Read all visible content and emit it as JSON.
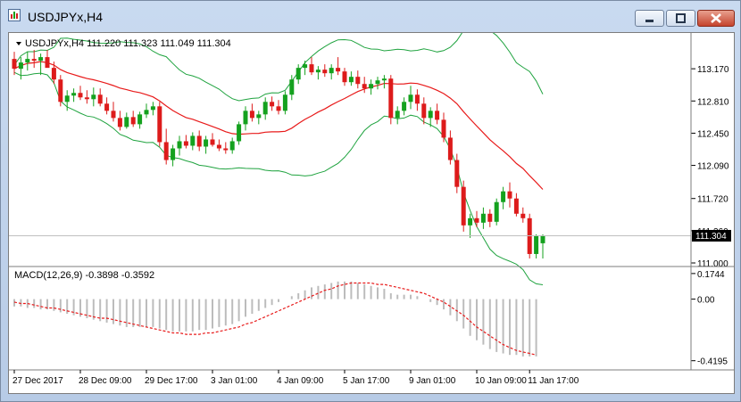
{
  "window": {
    "title": "USDJPYx,H4",
    "buttons": [
      "minimize-icon",
      "restore-icon",
      "close-icon"
    ]
  },
  "colors": {
    "bull": "#14a11e",
    "bear": "#dd1b1b",
    "ma": "#e81a1a",
    "bands": "#1fa33f",
    "macd_hist": "#bcbcbc",
    "signal": "#e81a1a",
    "price_box": "#000000"
  },
  "chart_data": [
    {
      "type": "candlestick",
      "symbol_info": "USDJPYx,H4  111.220 111.323 111.049 111.304",
      "ohlc": {
        "open": 111.22,
        "high": 111.323,
        "low": 111.049,
        "close": 111.304
      },
      "current_price_label": "111.304",
      "y_ticks": [
        "113.170",
        "112.810",
        "112.450",
        "112.090",
        "111.720",
        "111.360",
        "111.000"
      ],
      "ylim": [
        110.98,
        113.53
      ],
      "x_tick_labels": [
        "27 Dec 2017",
        "28 Dec 09:00",
        "29 Dec 17:00",
        "3 Jan 01:00",
        "4 Jan 09:00",
        "5 Jan 17:00",
        "9 Jan 01:00",
        "10 Jan 09:00",
        "11 Jan 17:00"
      ],
      "indicators": [
        "moving average (red)",
        "Bollinger/envelope bands (green)"
      ],
      "candles": [
        [
          113.28,
          113.36,
          113.1,
          113.17
        ],
        [
          113.17,
          113.3,
          113.05,
          113.24
        ],
        [
          113.24,
          113.36,
          113.15,
          113.28
        ],
        [
          113.28,
          113.38,
          113.18,
          113.26
        ],
        [
          113.26,
          113.34,
          113.1,
          113.3
        ],
        [
          113.3,
          113.38,
          113.2,
          113.18
        ],
        [
          113.18,
          113.25,
          113.0,
          113.05
        ],
        [
          113.05,
          113.1,
          112.75,
          112.8
        ],
        [
          112.8,
          112.93,
          112.7,
          112.87
        ],
        [
          112.87,
          112.95,
          112.8,
          112.9
        ],
        [
          112.9,
          112.98,
          112.82,
          112.85
        ],
        [
          112.85,
          112.93,
          112.78,
          112.83
        ],
        [
          112.83,
          112.96,
          112.75,
          112.88
        ],
        [
          112.88,
          112.95,
          112.75,
          112.78
        ],
        [
          112.78,
          112.85,
          112.66,
          112.7
        ],
        [
          112.7,
          112.8,
          112.58,
          112.62
        ],
        [
          112.62,
          112.7,
          112.48,
          112.52
        ],
        [
          112.52,
          112.68,
          112.5,
          112.63
        ],
        [
          112.63,
          112.7,
          112.52,
          112.55
        ],
        [
          112.55,
          112.69,
          112.5,
          112.66
        ],
        [
          112.66,
          112.78,
          112.62,
          112.71
        ],
        [
          112.71,
          112.8,
          112.65,
          112.75
        ],
        [
          112.75,
          112.8,
          112.3,
          112.35
        ],
        [
          112.35,
          112.5,
          112.1,
          112.15
        ],
        [
          112.15,
          112.32,
          112.08,
          112.28
        ],
        [
          112.28,
          112.42,
          112.2,
          112.36
        ],
        [
          112.36,
          112.43,
          112.28,
          112.31
        ],
        [
          112.31,
          112.46,
          112.26,
          112.42
        ],
        [
          112.42,
          112.48,
          112.25,
          112.3
        ],
        [
          112.3,
          112.42,
          112.22,
          112.38
        ],
        [
          112.38,
          112.45,
          112.3,
          112.32
        ],
        [
          112.32,
          112.38,
          112.25,
          112.28
        ],
        [
          112.28,
          112.35,
          112.22,
          112.26
        ],
        [
          112.26,
          112.4,
          112.22,
          112.36
        ],
        [
          112.36,
          112.58,
          112.32,
          112.55
        ],
        [
          112.55,
          112.75,
          112.48,
          112.7
        ],
        [
          112.7,
          112.78,
          112.58,
          112.62
        ],
        [
          112.62,
          112.7,
          112.55,
          112.66
        ],
        [
          112.66,
          112.85,
          112.6,
          112.8
        ],
        [
          112.8,
          112.86,
          112.7,
          112.75
        ],
        [
          112.75,
          112.82,
          112.66,
          112.7
        ],
        [
          112.7,
          112.92,
          112.66,
          112.88
        ],
        [
          112.88,
          113.1,
          112.82,
          113.05
        ],
        [
          113.05,
          113.22,
          113.0,
          113.18
        ],
        [
          113.18,
          113.26,
          113.1,
          113.22
        ],
        [
          113.22,
          113.3,
          113.1,
          113.13
        ],
        [
          113.13,
          113.2,
          113.05,
          113.16
        ],
        [
          113.16,
          113.22,
          113.08,
          113.12
        ],
        [
          113.12,
          113.22,
          113.05,
          113.18
        ],
        [
          113.18,
          113.3,
          113.1,
          113.14
        ],
        [
          113.14,
          113.18,
          112.98,
          113.02
        ],
        [
          113.02,
          113.14,
          112.98,
          113.08
        ],
        [
          113.08,
          113.15,
          112.95,
          113.0
        ],
        [
          113.0,
          113.08,
          112.9,
          112.95
        ],
        [
          112.95,
          113.05,
          112.88,
          113.0
        ],
        [
          113.0,
          113.08,
          112.94,
          113.04
        ],
        [
          113.04,
          113.1,
          112.95,
          113.06
        ],
        [
          113.06,
          113.1,
          112.55,
          112.62
        ],
        [
          112.62,
          112.75,
          112.55,
          112.7
        ],
        [
          112.7,
          112.85,
          112.65,
          112.8
        ],
        [
          112.8,
          112.98,
          112.72,
          112.88
        ],
        [
          112.88,
          112.94,
          112.7,
          112.78
        ],
        [
          112.78,
          112.85,
          112.55,
          112.62
        ],
        [
          112.62,
          112.74,
          112.52,
          112.7
        ],
        [
          112.7,
          112.78,
          112.55,
          112.6
        ],
        [
          112.6,
          112.68,
          112.35,
          112.4
        ],
        [
          112.4,
          112.48,
          112.1,
          112.15
        ],
        [
          112.15,
          112.22,
          111.78,
          111.85
        ],
        [
          111.85,
          111.92,
          111.35,
          111.42
        ],
        [
          111.42,
          111.55,
          111.28,
          111.5
        ],
        [
          111.5,
          111.58,
          111.4,
          111.45
        ],
        [
          111.45,
          111.62,
          111.38,
          111.55
        ],
        [
          111.55,
          111.6,
          111.4,
          111.46
        ],
        [
          111.46,
          111.72,
          111.42,
          111.68
        ],
        [
          111.68,
          111.85,
          111.6,
          111.8
        ],
        [
          111.8,
          111.9,
          111.62,
          111.72
        ],
        [
          111.72,
          111.78,
          111.52,
          111.55
        ],
        [
          111.55,
          111.62,
          111.45,
          111.5
        ],
        [
          111.5,
          111.55,
          111.05,
          111.1
        ],
        [
          111.1,
          111.32,
          111.05,
          111.3
        ],
        [
          111.22,
          111.32,
          111.05,
          111.3
        ]
      ]
    },
    {
      "type": "bar",
      "title": "MACD(12,26,9) -0.3898 -0.3592",
      "label": "MACD(12,26,9)",
      "values_text": [
        "-0.3898",
        "-0.3592"
      ],
      "y_ticks": [
        "0.1744",
        "0.00",
        "-0.4195"
      ],
      "ylim": [
        -0.47,
        0.21
      ],
      "histogram": [
        -0.05,
        -0.05,
        -0.06,
        -0.06,
        -0.07,
        -0.07,
        -0.08,
        -0.09,
        -0.1,
        -0.11,
        -0.12,
        -0.13,
        -0.14,
        -0.15,
        -0.16,
        -0.17,
        -0.18,
        -0.19,
        -0.19,
        -0.19,
        -0.19,
        -0.19,
        -0.2,
        -0.21,
        -0.22,
        -0.22,
        -0.22,
        -0.22,
        -0.21,
        -0.21,
        -0.2,
        -0.19,
        -0.18,
        -0.17,
        -0.15,
        -0.12,
        -0.1,
        -0.08,
        -0.06,
        -0.04,
        -0.02,
        0.0,
        0.02,
        0.04,
        0.06,
        0.08,
        0.09,
        0.1,
        0.11,
        0.12,
        0.12,
        0.12,
        0.11,
        0.1,
        0.09,
        0.08,
        0.07,
        0.04,
        0.03,
        0.03,
        0.03,
        0.02,
        0.0,
        -0.02,
        -0.04,
        -0.07,
        -0.11,
        -0.15,
        -0.2,
        -0.25,
        -0.28,
        -0.31,
        -0.34,
        -0.36,
        -0.37,
        -0.38,
        -0.38,
        -0.39,
        -0.39,
        -0.39
      ],
      "signal": [
        -0.02,
        -0.03,
        -0.03,
        -0.04,
        -0.05,
        -0.06,
        -0.06,
        -0.07,
        -0.08,
        -0.09,
        -0.1,
        -0.11,
        -0.12,
        -0.13,
        -0.13,
        -0.14,
        -0.15,
        -0.16,
        -0.17,
        -0.18,
        -0.19,
        -0.2,
        -0.21,
        -0.22,
        -0.23,
        -0.23,
        -0.24,
        -0.24,
        -0.24,
        -0.23,
        -0.23,
        -0.22,
        -0.21,
        -0.2,
        -0.19,
        -0.17,
        -0.16,
        -0.14,
        -0.12,
        -0.1,
        -0.08,
        -0.06,
        -0.04,
        -0.02,
        0.0,
        0.02,
        0.04,
        0.06,
        0.07,
        0.09,
        0.1,
        0.11,
        0.11,
        0.11,
        0.11,
        0.1,
        0.1,
        0.09,
        0.08,
        0.07,
        0.06,
        0.05,
        0.04,
        0.02,
        0.0,
        -0.02,
        -0.05,
        -0.08,
        -0.11,
        -0.15,
        -0.19,
        -0.22,
        -0.25,
        -0.28,
        -0.31,
        -0.33,
        -0.35,
        -0.36,
        -0.37,
        -0.38
      ]
    }
  ]
}
